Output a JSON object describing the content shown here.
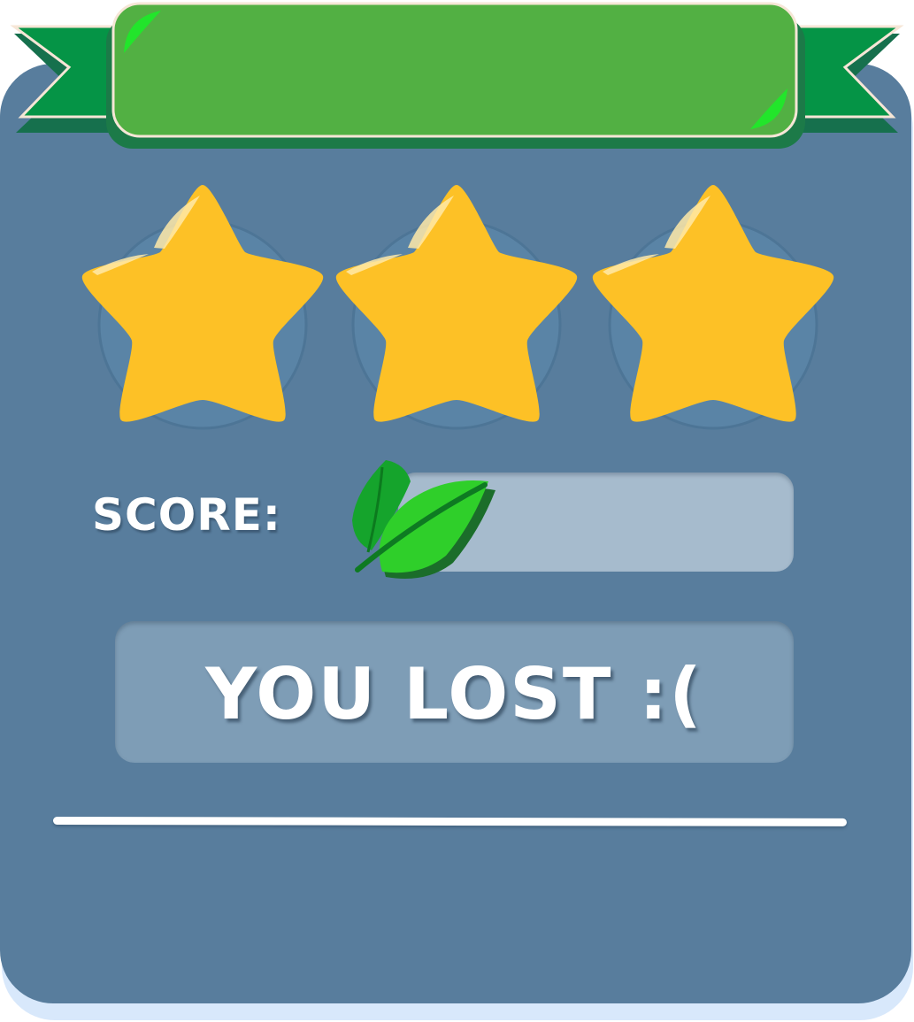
{
  "title_banner": {
    "title": ""
  },
  "rating": {
    "stars_total": 3,
    "stars_filled": 3
  },
  "score": {
    "label": "SCORE:",
    "value": "",
    "icon": "leaf-icon"
  },
  "result": {
    "message": "YOU LOST :("
  },
  "colors": {
    "panel": "#587d9d",
    "banner_green": "#52b043",
    "ribbon_green": "#059446",
    "star_gold": "#fdc126",
    "score_bar": "#a6bbcd",
    "result_box": "#7e9db6",
    "leaf_green": "#2fcf2a"
  }
}
